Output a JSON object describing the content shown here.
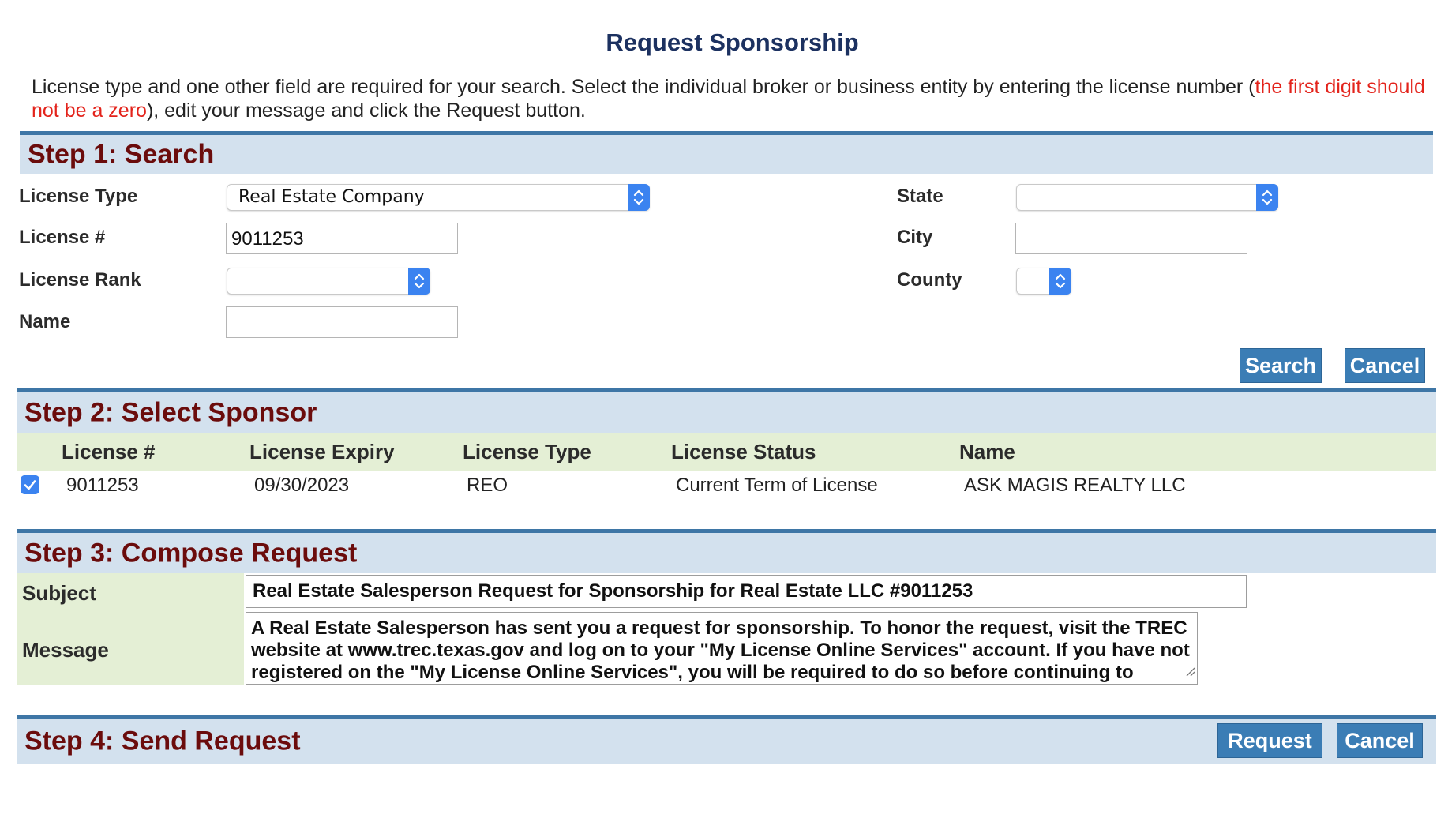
{
  "page": {
    "title": "Request Sponsorship",
    "intro_text_1": "License type and one other field are required for your search. Select the individual broker or business entity by entering the license number (",
    "intro_warning": "the first digit should not be a zero",
    "intro_text_2": "), edit your message and click the Request button."
  },
  "step1": {
    "title": "Step 1: Search",
    "license_type_label": "License Type",
    "license_type_value": "Real Estate Company",
    "license_number_label": "License #",
    "license_number_value": "9011253",
    "license_rank_label": "License Rank",
    "license_rank_value": "",
    "name_label": "Name",
    "name_value": "",
    "state_label": "State",
    "state_value": "",
    "city_label": "City",
    "city_value": "",
    "county_label": "County",
    "county_value": "",
    "search_button": "Search",
    "cancel_button": "Cancel"
  },
  "step2": {
    "title": "Step 2: Select Sponsor",
    "columns": [
      "License #",
      "License Expiry",
      "License Type",
      "License Status",
      "Name"
    ],
    "rows": [
      {
        "checked": true,
        "license": "9011253",
        "expiry": "09/30/2023",
        "type": "REO",
        "status": "Current Term of License",
        "name": "ASK MAGIS REALTY LLC"
      }
    ]
  },
  "step3": {
    "title": "Step 3: Compose Request",
    "subject_label": "Subject",
    "subject_value": "Real Estate Salesperson Request for Sponsorship for Real Estate LLC #9011253",
    "message_label": "Message",
    "message_value": "A Real Estate Salesperson has sent you a request for sponsorship.  To honor the request, visit the TREC website at www.trec.texas.gov and log on to your \"My License Online Services\" account.  If you have not registered on the \"My License Online Services\", you will be required to do so before continuing to"
  },
  "step4": {
    "title": "Step 4: Send Request",
    "request_button": "Request",
    "cancel_button": "Cancel"
  },
  "colors": {
    "title": "#1c3160",
    "step_title": "#6b0c0c",
    "step_bar": "#d3e1ee",
    "step_border": "#3e76a6",
    "label_column": "#e4efd5",
    "button": "#3b7db5",
    "warning_text": "#e3231b"
  },
  "icons": {
    "select_arrow": "chevron-up-down-icon",
    "checkbox": "checkmark-icon",
    "resize_handle": "resize-grip-icon"
  }
}
